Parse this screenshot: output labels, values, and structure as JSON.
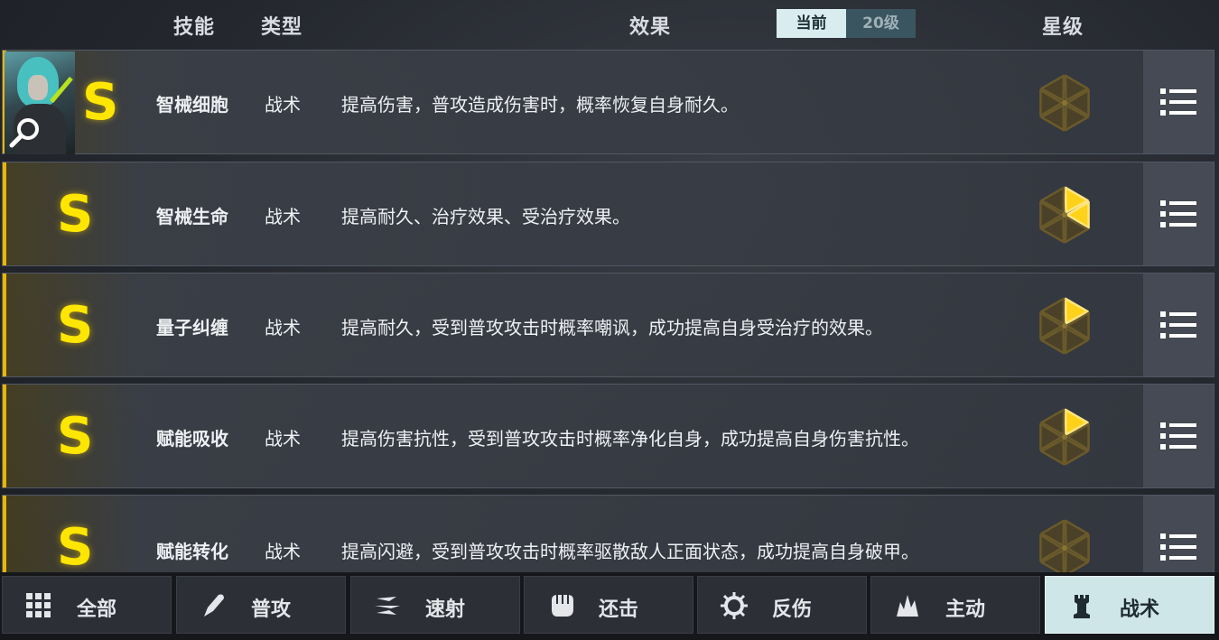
{
  "header": {
    "col_skill": "技能",
    "col_type": "类型",
    "col_effect": "效果",
    "toggle_current": "当前",
    "toggle_level": "20级",
    "col_star": "星级"
  },
  "skills": [
    {
      "rank": "S",
      "name": "智械细胞",
      "type": "战术",
      "desc": "提高伤害，普攻造成伤害时，概率恢复自身耐久。",
      "star_icon": "star-hexagon-icon",
      "stars_filled": 0
    },
    {
      "rank": "S",
      "name": "智械生命",
      "type": "战术",
      "desc": "提高耐久、治疗效果、受治疗效果。",
      "star_icon": "star-hexagon-icon",
      "stars_filled": 2
    },
    {
      "rank": "S",
      "name": "量子纠缠",
      "type": "战术",
      "desc": "提高耐久，受到普攻攻击时概率嘲讽，成功提高自身受治疗的效果。",
      "star_icon": "star-hexagon-icon",
      "stars_filled": 1
    },
    {
      "rank": "S",
      "name": "赋能吸收",
      "type": "战术",
      "desc": "提高伤害抗性，受到普攻攻击时概率净化自身，成功提高自身伤害抗性。",
      "star_icon": "star-hexagon-icon",
      "stars_filled": 1
    },
    {
      "rank": "S",
      "name": "赋能转化",
      "type": "战术",
      "desc": "提高闪避，受到普攻攻击时概率驱散敌人正面状态，成功提高自身破甲。",
      "star_icon": "star-hexagon-icon",
      "stars_filled": 0
    }
  ],
  "tabs": [
    {
      "label": "全部",
      "icon": "grid-icon"
    },
    {
      "label": "普攻",
      "icon": "bullet-icon"
    },
    {
      "label": "速射",
      "icon": "rapid-fire-icon"
    },
    {
      "label": "还击",
      "icon": "fist-icon"
    },
    {
      "label": "反伤",
      "icon": "gear-icon"
    },
    {
      "label": "主动",
      "icon": "flame-icon"
    },
    {
      "label": "战术",
      "icon": "tower-icon"
    }
  ],
  "active_tab": 6,
  "colors": {
    "rank_gold": "#ffe600",
    "star_filled": "#ffd21a",
    "star_empty": "#6a5a2a",
    "active_tab_bg": "#cfe6e8"
  }
}
